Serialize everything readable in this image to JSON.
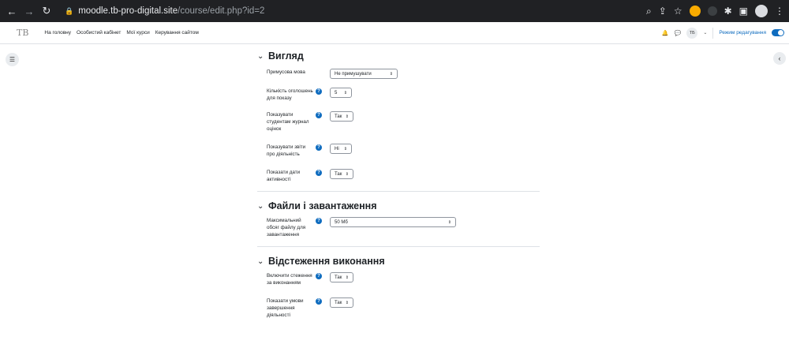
{
  "browser": {
    "url_host": "moodle.tb-pro-digital.site",
    "url_path": "/course/edit.php?id=2"
  },
  "topnav": {
    "logo": "TB",
    "links": [
      "На головну",
      "Особистий кабінет",
      "Мої курси",
      "Керування сайтом"
    ],
    "user_initials": "ТБ",
    "edit_mode_label": "Режим редагування"
  },
  "sections": {
    "appearance": {
      "title": "Вигляд",
      "fields": [
        {
          "label": "Примусова мова",
          "value": "Не примушувати"
        },
        {
          "label": "Кількість оголошень для показу",
          "value": "5"
        },
        {
          "label": "Показувати студентам журнал оцінок",
          "value": "Так"
        },
        {
          "label": "Показувати звіти про діяльність",
          "value": "Ні"
        },
        {
          "label": "Показати дати активності",
          "value": "Так"
        }
      ]
    },
    "files": {
      "title": "Файли і завантаження",
      "fields": [
        {
          "label": "Максимальний обсяг файлу для завантаження",
          "value": "50 Мб"
        }
      ]
    },
    "completion": {
      "title": "Відстеження виконання",
      "fields": [
        {
          "label": "Включити стеження за виконанням",
          "value": "Так"
        },
        {
          "label": "Показати умови завершення діяльності",
          "value": "Так"
        }
      ]
    }
  }
}
